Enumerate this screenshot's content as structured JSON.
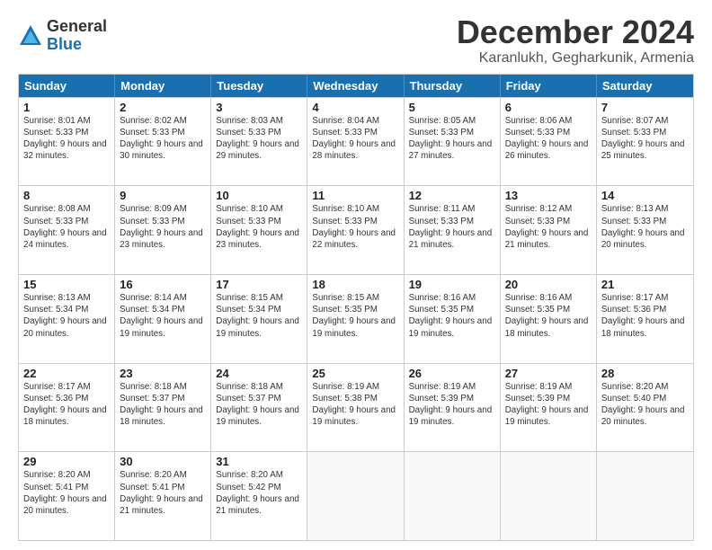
{
  "logo": {
    "general": "General",
    "blue": "Blue"
  },
  "title": "December 2024",
  "location": "Karanlukh, Gegharkunik, Armenia",
  "days_of_week": [
    "Sunday",
    "Monday",
    "Tuesday",
    "Wednesday",
    "Thursday",
    "Friday",
    "Saturday"
  ],
  "weeks": [
    [
      {
        "day": "1",
        "sunrise": "Sunrise: 8:01 AM",
        "sunset": "Sunset: 5:33 PM",
        "daylight": "Daylight: 9 hours and 32 minutes."
      },
      {
        "day": "2",
        "sunrise": "Sunrise: 8:02 AM",
        "sunset": "Sunset: 5:33 PM",
        "daylight": "Daylight: 9 hours and 30 minutes."
      },
      {
        "day": "3",
        "sunrise": "Sunrise: 8:03 AM",
        "sunset": "Sunset: 5:33 PM",
        "daylight": "Daylight: 9 hours and 29 minutes."
      },
      {
        "day": "4",
        "sunrise": "Sunrise: 8:04 AM",
        "sunset": "Sunset: 5:33 PM",
        "daylight": "Daylight: 9 hours and 28 minutes."
      },
      {
        "day": "5",
        "sunrise": "Sunrise: 8:05 AM",
        "sunset": "Sunset: 5:33 PM",
        "daylight": "Daylight: 9 hours and 27 minutes."
      },
      {
        "day": "6",
        "sunrise": "Sunrise: 8:06 AM",
        "sunset": "Sunset: 5:33 PM",
        "daylight": "Daylight: 9 hours and 26 minutes."
      },
      {
        "day": "7",
        "sunrise": "Sunrise: 8:07 AM",
        "sunset": "Sunset: 5:33 PM",
        "daylight": "Daylight: 9 hours and 25 minutes."
      }
    ],
    [
      {
        "day": "8",
        "sunrise": "Sunrise: 8:08 AM",
        "sunset": "Sunset: 5:33 PM",
        "daylight": "Daylight: 9 hours and 24 minutes."
      },
      {
        "day": "9",
        "sunrise": "Sunrise: 8:09 AM",
        "sunset": "Sunset: 5:33 PM",
        "daylight": "Daylight: 9 hours and 23 minutes."
      },
      {
        "day": "10",
        "sunrise": "Sunrise: 8:10 AM",
        "sunset": "Sunset: 5:33 PM",
        "daylight": "Daylight: 9 hours and 23 minutes."
      },
      {
        "day": "11",
        "sunrise": "Sunrise: 8:10 AM",
        "sunset": "Sunset: 5:33 PM",
        "daylight": "Daylight: 9 hours and 22 minutes."
      },
      {
        "day": "12",
        "sunrise": "Sunrise: 8:11 AM",
        "sunset": "Sunset: 5:33 PM",
        "daylight": "Daylight: 9 hours and 21 minutes."
      },
      {
        "day": "13",
        "sunrise": "Sunrise: 8:12 AM",
        "sunset": "Sunset: 5:33 PM",
        "daylight": "Daylight: 9 hours and 21 minutes."
      },
      {
        "day": "14",
        "sunrise": "Sunrise: 8:13 AM",
        "sunset": "Sunset: 5:33 PM",
        "daylight": "Daylight: 9 hours and 20 minutes."
      }
    ],
    [
      {
        "day": "15",
        "sunrise": "Sunrise: 8:13 AM",
        "sunset": "Sunset: 5:34 PM",
        "daylight": "Daylight: 9 hours and 20 minutes."
      },
      {
        "day": "16",
        "sunrise": "Sunrise: 8:14 AM",
        "sunset": "Sunset: 5:34 PM",
        "daylight": "Daylight: 9 hours and 19 minutes."
      },
      {
        "day": "17",
        "sunrise": "Sunrise: 8:15 AM",
        "sunset": "Sunset: 5:34 PM",
        "daylight": "Daylight: 9 hours and 19 minutes."
      },
      {
        "day": "18",
        "sunrise": "Sunrise: 8:15 AM",
        "sunset": "Sunset: 5:35 PM",
        "daylight": "Daylight: 9 hours and 19 minutes."
      },
      {
        "day": "19",
        "sunrise": "Sunrise: 8:16 AM",
        "sunset": "Sunset: 5:35 PM",
        "daylight": "Daylight: 9 hours and 19 minutes."
      },
      {
        "day": "20",
        "sunrise": "Sunrise: 8:16 AM",
        "sunset": "Sunset: 5:35 PM",
        "daylight": "Daylight: 9 hours and 18 minutes."
      },
      {
        "day": "21",
        "sunrise": "Sunrise: 8:17 AM",
        "sunset": "Sunset: 5:36 PM",
        "daylight": "Daylight: 9 hours and 18 minutes."
      }
    ],
    [
      {
        "day": "22",
        "sunrise": "Sunrise: 8:17 AM",
        "sunset": "Sunset: 5:36 PM",
        "daylight": "Daylight: 9 hours and 18 minutes."
      },
      {
        "day": "23",
        "sunrise": "Sunrise: 8:18 AM",
        "sunset": "Sunset: 5:37 PM",
        "daylight": "Daylight: 9 hours and 18 minutes."
      },
      {
        "day": "24",
        "sunrise": "Sunrise: 8:18 AM",
        "sunset": "Sunset: 5:37 PM",
        "daylight": "Daylight: 9 hours and 19 minutes."
      },
      {
        "day": "25",
        "sunrise": "Sunrise: 8:19 AM",
        "sunset": "Sunset: 5:38 PM",
        "daylight": "Daylight: 9 hours and 19 minutes."
      },
      {
        "day": "26",
        "sunrise": "Sunrise: 8:19 AM",
        "sunset": "Sunset: 5:39 PM",
        "daylight": "Daylight: 9 hours and 19 minutes."
      },
      {
        "day": "27",
        "sunrise": "Sunrise: 8:19 AM",
        "sunset": "Sunset: 5:39 PM",
        "daylight": "Daylight: 9 hours and 19 minutes."
      },
      {
        "day": "28",
        "sunrise": "Sunrise: 8:20 AM",
        "sunset": "Sunset: 5:40 PM",
        "daylight": "Daylight: 9 hours and 20 minutes."
      }
    ],
    [
      {
        "day": "29",
        "sunrise": "Sunrise: 8:20 AM",
        "sunset": "Sunset: 5:41 PM",
        "daylight": "Daylight: 9 hours and 20 minutes."
      },
      {
        "day": "30",
        "sunrise": "Sunrise: 8:20 AM",
        "sunset": "Sunset: 5:41 PM",
        "daylight": "Daylight: 9 hours and 21 minutes."
      },
      {
        "day": "31",
        "sunrise": "Sunrise: 8:20 AM",
        "sunset": "Sunset: 5:42 PM",
        "daylight": "Daylight: 9 hours and 21 minutes."
      },
      {
        "day": "",
        "sunrise": "",
        "sunset": "",
        "daylight": ""
      },
      {
        "day": "",
        "sunrise": "",
        "sunset": "",
        "daylight": ""
      },
      {
        "day": "",
        "sunrise": "",
        "sunset": "",
        "daylight": ""
      },
      {
        "day": "",
        "sunrise": "",
        "sunset": "",
        "daylight": ""
      }
    ]
  ]
}
